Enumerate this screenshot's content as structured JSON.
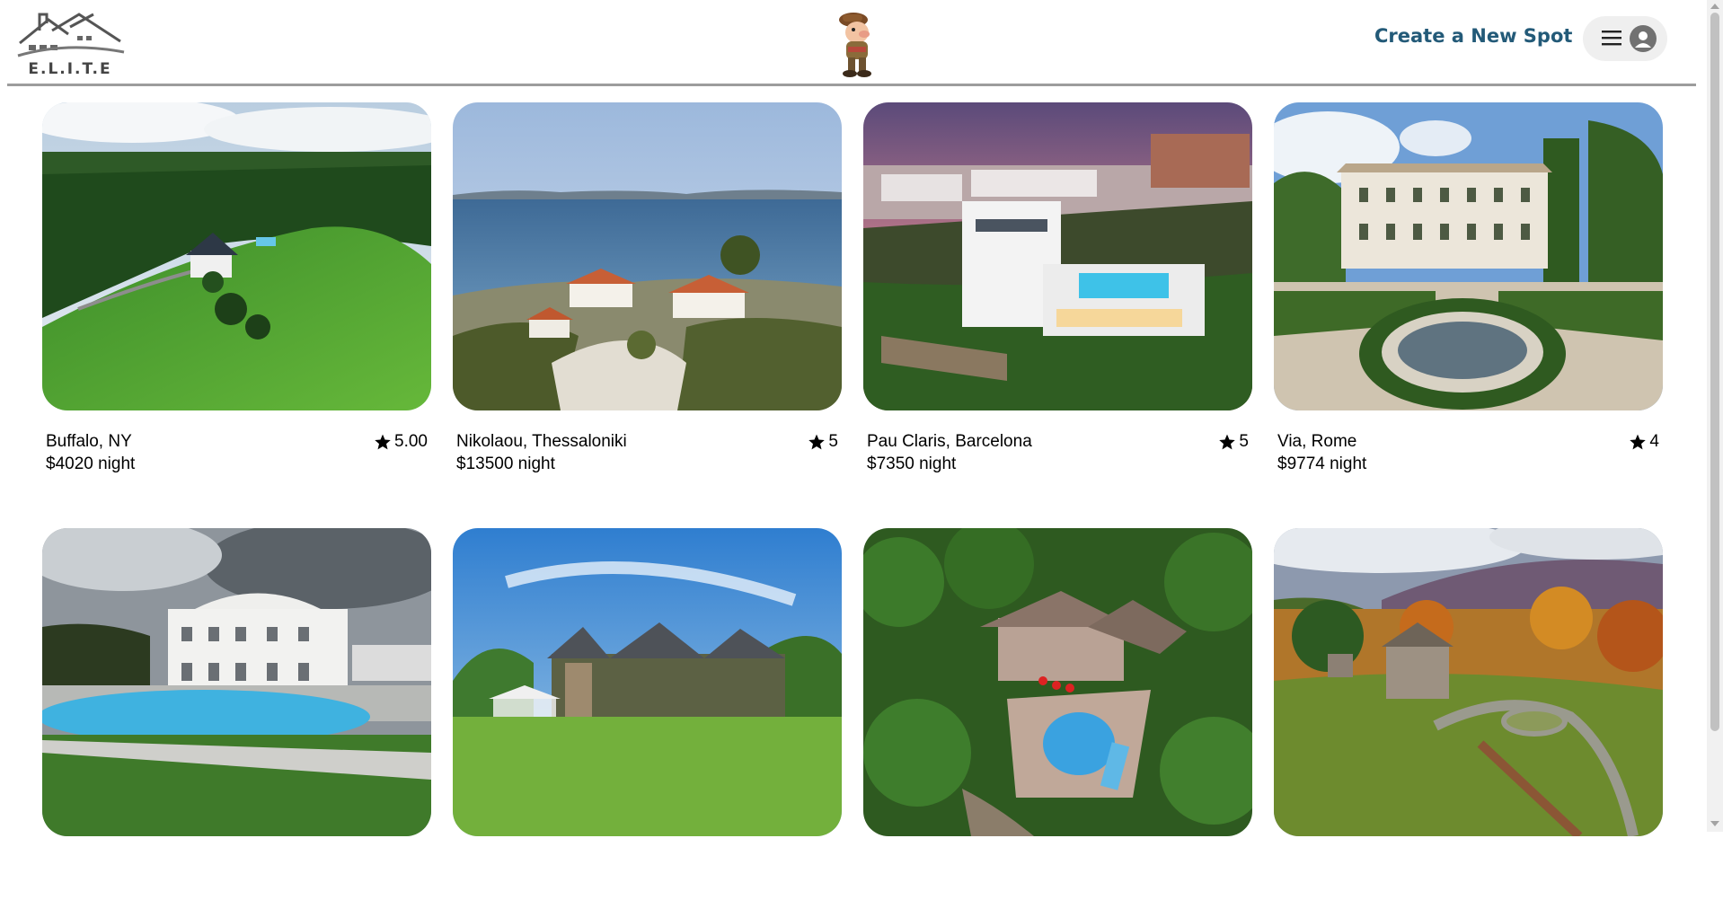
{
  "header": {
    "logo_text": "E.L.I.T.E",
    "create_spot_label": "Create a New Spot",
    "menu_icon": "hamburger-menu-icon",
    "avatar_icon": "user-avatar-icon",
    "brand_color": "#235a78"
  },
  "spots": [
    {
      "location": "Buffalo, NY",
      "rating": "5.00",
      "price": "$4020 night",
      "scene": "green-hills-house"
    },
    {
      "location": "Nikolaou, Thessaloniki",
      "rating": "5",
      "price": "$13500 night",
      "scene": "seaside-villa"
    },
    {
      "location": "Pau Claris, Barcelona",
      "rating": "5",
      "price": "$7350 night",
      "scene": "modern-villa-sunset"
    },
    {
      "location": "Via, Rome",
      "rating": "4",
      "price": "$9774 night",
      "scene": "italian-villa-garden"
    },
    {
      "location": "",
      "rating": "",
      "price": "",
      "scene": "white-mansion-pool"
    },
    {
      "location": "",
      "rating": "",
      "price": "",
      "scene": "stone-manor-lawn"
    },
    {
      "location": "",
      "rating": "",
      "price": "",
      "scene": "forest-house-pool"
    },
    {
      "location": "",
      "rating": "",
      "price": "",
      "scene": "stone-barn-autumn"
    }
  ],
  "icons": {
    "star": "star-icon"
  }
}
